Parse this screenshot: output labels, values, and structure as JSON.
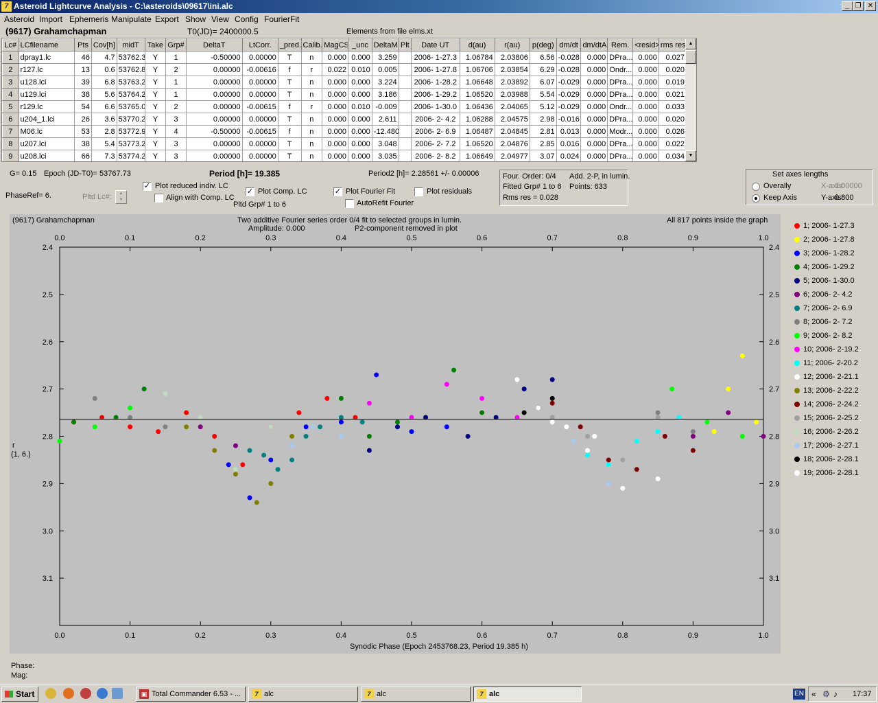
{
  "window": {
    "title": "Asteroid Lightcurve Analysis - C:\\asteroids\\09617\\ini.alc",
    "icon_name": "alc-app-icon"
  },
  "menu": [
    "Asteroid",
    "Import",
    "Ephemeris",
    "Manipulate",
    "Export",
    "Show",
    "View",
    "Config",
    "FourierFit"
  ],
  "header": {
    "asteroid": "(9617) Grahamchapman",
    "t0": "T0(JD)= 2400000.5",
    "elements": "Elements from file elms.xt"
  },
  "table": {
    "columns": [
      "Lc#",
      "LCfilename",
      "Pts",
      "Cov[h]",
      "midT",
      "Take",
      "Grp#",
      "DeltaT",
      "LtCorr.",
      "_pred.",
      "Calib.",
      "MagCS",
      "_unc",
      "DeltaM",
      "Plt",
      "Date UT",
      "d(au)",
      "r(au)",
      "p(deg)",
      "dm/dt",
      "dm/dtA",
      "Rem.",
      "<resid>",
      "rms res"
    ],
    "rows": [
      [
        "1",
        "dpray1.lc",
        "46",
        "4.7",
        "53762.3",
        "Y",
        "1",
        "-0.50000",
        "0.00000",
        "T",
        "n",
        "0.000",
        "0.000",
        "3.259",
        "",
        "2006- 1-27.3",
        "1.06784",
        "2.03806",
        "6.56",
        "-0.028",
        "0.000",
        "DPra...",
        "0.000",
        "0.027"
      ],
      [
        "2",
        "r127.lc",
        "13",
        "0.6",
        "53762.8",
        "Y",
        "2",
        "0.00000",
        "-0.00616",
        "f",
        "r",
        "0.022",
        "0.010",
        "0.005",
        "",
        "2006- 1-27.8",
        "1.06706",
        "2.03854",
        "6.29",
        "-0.028",
        "0.000",
        "Ondr...",
        "0.000",
        "0.020"
      ],
      [
        "3",
        "u128.lci",
        "39",
        "6.8",
        "53763.2",
        "Y",
        "1",
        "0.00000",
        "0.00000",
        "T",
        "n",
        "0.000",
        "0.000",
        "3.224",
        "",
        "2006- 1-28.2",
        "1.06648",
        "2.03892",
        "6.07",
        "-0.029",
        "0.000",
        "DPra...",
        "0.000",
        "0.019"
      ],
      [
        "4",
        "u129.lci",
        "38",
        "5.6",
        "53764.2",
        "Y",
        "1",
        "0.00000",
        "0.00000",
        "T",
        "n",
        "0.000",
        "0.000",
        "3.186",
        "",
        "2006- 1-29.2",
        "1.06520",
        "2.03988",
        "5.54",
        "-0.029",
        "0.000",
        "DPra...",
        "0.000",
        "0.021"
      ],
      [
        "5",
        "r129.lc",
        "54",
        "6.6",
        "53765.0",
        "Y",
        "2",
        "0.00000",
        "-0.00615",
        "f",
        "r",
        "0.000",
        "0.010",
        "-0.009",
        "",
        "2006- 1-30.0",
        "1.06436",
        "2.04065",
        "5.12",
        "-0.029",
        "0.000",
        "Ondr...",
        "0.000",
        "0.033"
      ],
      [
        "6",
        "u204_1.lci",
        "26",
        "3.6",
        "53770.2",
        "Y",
        "3",
        "0.00000",
        "0.00000",
        "T",
        "n",
        "0.000",
        "0.000",
        "2.611",
        "",
        "2006- 2- 4.2",
        "1.06288",
        "2.04575",
        "2.98",
        "-0.016",
        "0.000",
        "DPra...",
        "0.000",
        "0.020"
      ],
      [
        "7",
        "M06.lc",
        "53",
        "2.8",
        "53772.9",
        "Y",
        "4",
        "-0.50000",
        "-0.00615",
        "f",
        "n",
        "0.000",
        "0.000",
        "-12.480",
        "",
        "2006- 2- 6.9",
        "1.06487",
        "2.04845",
        "2.81",
        "0.013",
        "0.000",
        "Modr...",
        "0.000",
        "0.026"
      ],
      [
        "8",
        "u207.lci",
        "38",
        "5.4",
        "53773.2",
        "Y",
        "3",
        "0.00000",
        "0.00000",
        "T",
        "n",
        "0.000",
        "0.000",
        "3.048",
        "",
        "2006- 2- 7.2",
        "1.06520",
        "2.04876",
        "2.85",
        "0.016",
        "0.000",
        "DPra...",
        "0.000",
        "0.022"
      ],
      [
        "9",
        "u208.lci",
        "66",
        "7.3",
        "53774.2",
        "Y",
        "3",
        "0.00000",
        "0.00000",
        "T",
        "n",
        "0.000",
        "0.000",
        "3.035",
        "",
        "2006- 2- 8.2",
        "1.06649",
        "2.04977",
        "3.07",
        "0.024",
        "0.000",
        "DPra...",
        "0.000",
        "0.034"
      ]
    ]
  },
  "info": {
    "g": "G= 0.15",
    "epoch": "Epoch (JD-T0)= 53767.73",
    "period": "Period [h]= 19.385",
    "period2": "Period2 [h]= 2.28561 +/- 0.00006",
    "phaseref": "PhaseRef= 6.",
    "pltd_lc": "Pltd Lc#:"
  },
  "options": {
    "plot_reduced": {
      "label": "Plot reduced indiv. LC",
      "checked": true
    },
    "align_comp": {
      "label": "Align with Comp. LC",
      "checked": false
    },
    "plot_comp": {
      "label": "Plot Comp. LC",
      "checked": true
    },
    "pltd_grp": "Pltd Grp#  1   to   6",
    "plot_fourier": {
      "label": "Plot Fourier Fit",
      "checked": true
    },
    "autorefit": {
      "label": "AutoRefit Fourier",
      "checked": false
    },
    "plot_residuals": {
      "label": "Plot residuals",
      "checked": false
    }
  },
  "fourier_box": {
    "order": "Four. Order:  0/4",
    "add": "Add. 2-P, in lumin.",
    "fitted": "Fitted Grp# 1 to 6",
    "points": "Points: 633",
    "rms": "Rms res      = 0.028"
  },
  "axes_box": {
    "title": "Set axes lengths",
    "overall": "Overally",
    "keep": "Keep Axis",
    "xaxis_label": "X-axis:",
    "xaxis_value": "1.00000",
    "yaxis_label": "Y-axis:",
    "yaxis_value": "0.800",
    "selected": "keep"
  },
  "plot": {
    "name": "(9617) Grahamchapman",
    "subtitle1": "Two additive Fourier series order 0/4 fit to selected groups in lumin.",
    "amplitude": "Amplitude: 0.000",
    "subtitle2": "P2-component removed in plot",
    "inside": "All 817 points inside the graph",
    "ylabel1": "r",
    "ylabel2": "(1, 6.)",
    "phase_label": "Phase:",
    "mag_label": "Mag:"
  },
  "chart_data": {
    "type": "scatter",
    "xlabel": "Synodic Phase (Epoch 2453768.23, Period 19.385 h)",
    "ylabel": "r (1, 6.)",
    "xlim": [
      0.0,
      1.0
    ],
    "ylim": [
      3.2,
      2.4
    ],
    "y_inverted": true,
    "x_ticks": [
      "0.0",
      "0.1",
      "0.2",
      "0.3",
      "0.4",
      "0.5",
      "0.6",
      "0.7",
      "0.8",
      "0.9",
      "1.0"
    ],
    "y_ticks": [
      "2.4",
      "2.5",
      "2.6",
      "2.7",
      "2.8",
      "2.9",
      "3.0",
      "3.1"
    ],
    "fit_line": 2.764,
    "series": [
      {
        "name": "1; 2006- 1-27.3",
        "color": "#ff0000",
        "x": [
          0.02,
          0.06,
          0.1,
          0.14,
          0.18,
          0.22,
          0.26,
          0.3,
          0.34,
          0.38,
          0.42
        ],
        "y": [
          2.77,
          2.76,
          2.78,
          2.79,
          2.75,
          2.8,
          2.86,
          2.78,
          2.75,
          2.72,
          2.76
        ]
      },
      {
        "name": "2; 2006- 1-27.8",
        "color": "#ffff00",
        "x": [
          0.93,
          0.95,
          0.97,
          0.99
        ],
        "y": [
          2.79,
          2.7,
          2.63,
          2.77
        ]
      },
      {
        "name": "3; 2006- 1-28.2",
        "color": "#0000ff",
        "x": [
          0.24,
          0.27,
          0.3,
          0.35,
          0.4,
          0.45,
          0.5,
          0.55
        ],
        "y": [
          2.86,
          2.93,
          2.85,
          2.78,
          2.77,
          2.67,
          2.79,
          2.78
        ]
      },
      {
        "name": "4; 2006- 1-29.2",
        "color": "#008000",
        "x": [
          0.02,
          0.08,
          0.12,
          0.4,
          0.44,
          0.48,
          0.52,
          0.56,
          0.6
        ],
        "y": [
          2.77,
          2.76,
          2.7,
          2.72,
          2.8,
          2.77,
          2.76,
          2.66,
          2.75
        ]
      },
      {
        "name": "5; 2006- 1-30.0",
        "color": "#000080",
        "x": [
          0.44,
          0.48,
          0.52,
          0.58,
          0.62,
          0.66,
          0.7
        ],
        "y": [
          2.83,
          2.78,
          2.76,
          2.8,
          2.76,
          2.7,
          2.68
        ]
      },
      {
        "name": "6; 2006- 2- 4.2",
        "color": "#800080",
        "x": [
          0.2,
          0.25,
          0.9,
          0.95,
          1.0
        ],
        "y": [
          2.78,
          2.82,
          2.8,
          2.75,
          2.8
        ]
      },
      {
        "name": "7; 2006- 2- 6.9",
        "color": "#008080",
        "x": [
          0.27,
          0.29,
          0.31,
          0.33,
          0.35,
          0.37,
          0.4,
          0.43
        ],
        "y": [
          2.83,
          2.84,
          2.87,
          2.85,
          2.8,
          2.78,
          2.76,
          2.77
        ]
      },
      {
        "name": "8; 2006- 2- 7.2",
        "color": "#808080",
        "x": [
          0.05,
          0.1,
          0.15,
          0.85,
          0.9
        ],
        "y": [
          2.72,
          2.76,
          2.78,
          2.75,
          2.79
        ]
      },
      {
        "name": "9; 2006- 2- 8.2",
        "color": "#00ff00",
        "x": [
          0.0,
          0.05,
          0.1,
          0.87,
          0.92,
          0.97
        ],
        "y": [
          2.81,
          2.78,
          2.74,
          2.7,
          2.77,
          2.8
        ]
      },
      {
        "name": "10; 2006- 2-19.2",
        "color": "#ff00ff",
        "x": [
          0.44,
          0.5,
          0.55,
          0.6,
          0.65
        ],
        "y": [
          2.73,
          2.76,
          2.69,
          2.72,
          2.76
        ]
      },
      {
        "name": "11; 2006- 2-20.2",
        "color": "#00ffff",
        "x": [
          0.75,
          0.78,
          0.82,
          0.85,
          0.88
        ],
        "y": [
          2.84,
          2.86,
          2.81,
          2.79,
          2.76
        ]
      },
      {
        "name": "12; 2006- 2-21.1",
        "color": "#ffffff",
        "x": [
          0.65,
          0.7,
          0.75,
          0.8,
          0.85
        ],
        "y": [
          2.68,
          2.77,
          2.83,
          2.91,
          2.89
        ]
      },
      {
        "name": "13; 2006- 2-22.2",
        "color": "#808000",
        "x": [
          0.18,
          0.22,
          0.25,
          0.28,
          0.3,
          0.33
        ],
        "y": [
          2.78,
          2.83,
          2.88,
          2.94,
          2.9,
          2.8
        ]
      },
      {
        "name": "14; 2006- 2-24.2",
        "color": "#800000",
        "x": [
          0.7,
          0.74,
          0.78,
          0.82,
          0.86,
          0.9
        ],
        "y": [
          2.73,
          2.78,
          2.85,
          2.87,
          2.8,
          2.83
        ]
      },
      {
        "name": "15; 2006- 2-25.2",
        "color": "#a0a0a0",
        "x": [
          0.7,
          0.75,
          0.8,
          0.85
        ],
        "y": [
          2.76,
          2.8,
          2.85,
          2.76
        ]
      },
      {
        "name": "16; 2006- 2-26.2",
        "color": "#c0dcc0",
        "x": [
          0.15,
          0.2,
          0.25,
          0.3
        ],
        "y": [
          2.71,
          2.76,
          2.87,
          2.78
        ]
      },
      {
        "name": "17; 2006- 2-27.1",
        "color": "#a6caf0",
        "x": [
          0.33,
          0.36,
          0.4,
          0.73,
          0.78
        ],
        "y": [
          2.82,
          2.78,
          2.8,
          2.81,
          2.9
        ]
      },
      {
        "name": "18; 2006- 2-28.1",
        "color": "#000000",
        "x": [
          0.66,
          0.68,
          0.7
        ],
        "y": [
          2.75,
          2.74,
          2.72
        ]
      },
      {
        "name": "19; 2006- 2-28.1",
        "color": "#ffffff",
        "x": [
          0.68,
          0.72,
          0.76
        ],
        "y": [
          2.74,
          2.78,
          2.8
        ]
      }
    ]
  },
  "taskbar": {
    "start": "Start",
    "buttons": [
      "Total Commander 6.53 - ...",
      "alc",
      "alc",
      "alc"
    ],
    "active_index": 3,
    "lang": "EN",
    "clock": "17:37",
    "tray_arrows": "«"
  }
}
